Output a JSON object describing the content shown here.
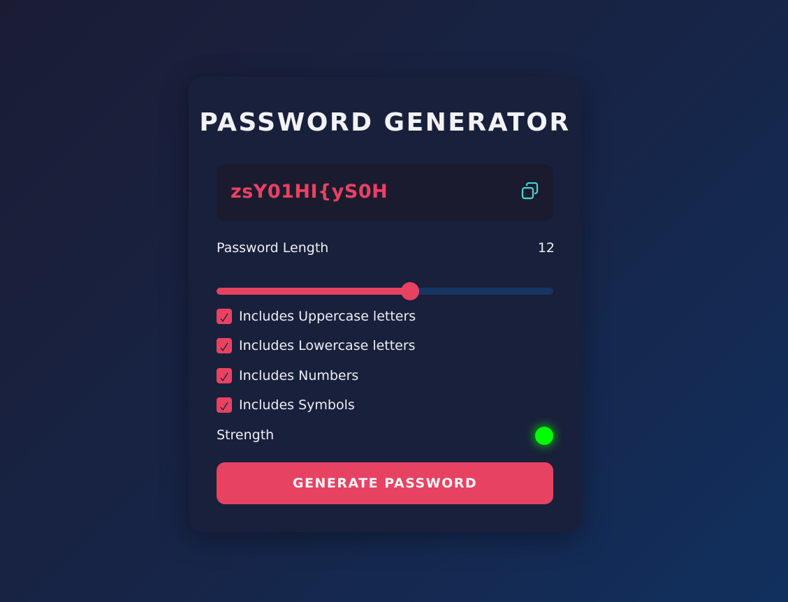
{
  "app": {
    "title": "PASSWORD GENERATOR"
  },
  "password": {
    "value": "zsY01HI{yS0H",
    "copy_icon": "copy-icon"
  },
  "length": {
    "label": "Password Length",
    "value": "12",
    "slider_fraction": 0.575
  },
  "options": [
    {
      "label": "Includes Uppercase letters",
      "checked": true
    },
    {
      "label": "Includes Lowercase letters",
      "checked": true
    },
    {
      "label": "Includes Numbers",
      "checked": true
    },
    {
      "label": "Includes Symbols",
      "checked": true
    }
  ],
  "strength": {
    "label": "Strength",
    "color": "#00ff00"
  },
  "generate_button": {
    "label": "GENERATE PASSWORD"
  },
  "colors": {
    "accent": "#e84262",
    "copy_icon": "#4ed3d3",
    "slider_track": "#163563",
    "card": "#19203b"
  }
}
